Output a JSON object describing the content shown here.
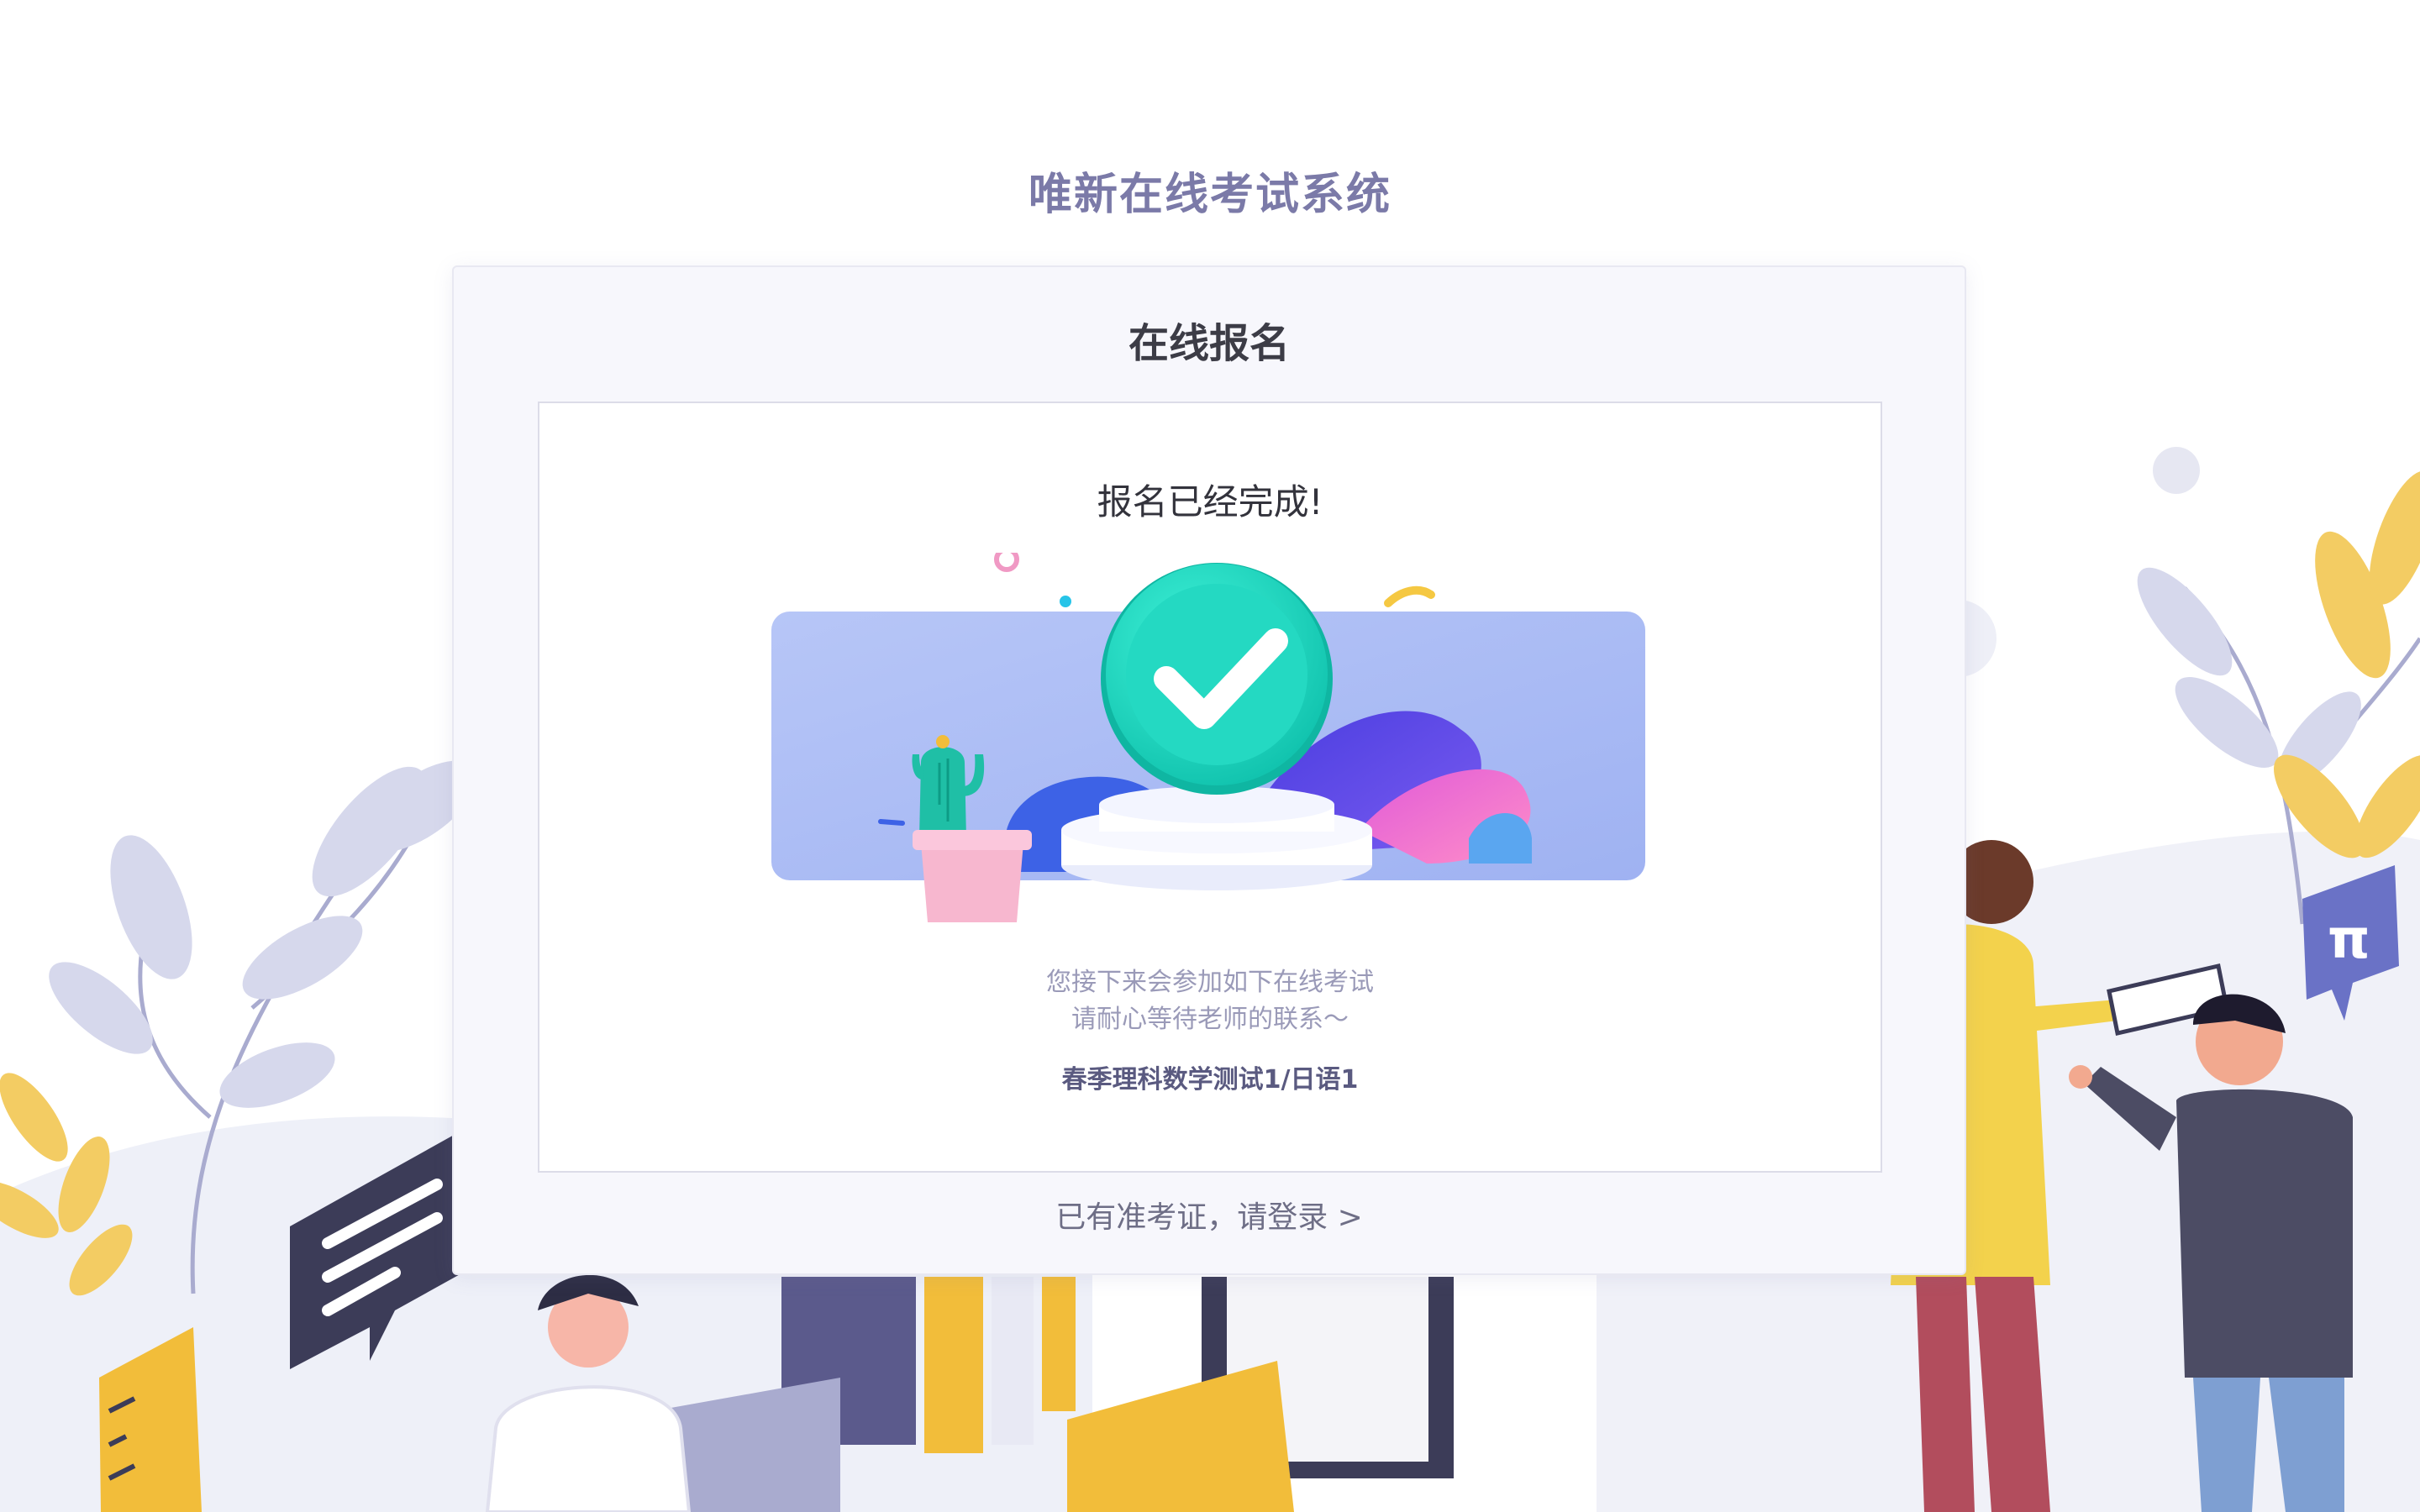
{
  "header": {
    "system_title": "唯新在线考试系统"
  },
  "card": {
    "title": "在线报名",
    "status_text": "报名已经完成!",
    "message_line1": "您接下来会参加如下在线考试",
    "message_line2": "请耐心等待老师的联系～",
    "exam_name": "春季理科数学测试1/日语1",
    "login_link": "已有准考证，请登录 >"
  },
  "colors": {
    "title": "#7b7aa8",
    "check_badge": "#22dfc6",
    "banner": "#a6b8f5"
  },
  "icons": {
    "success": "check-icon",
    "pi_bubble": "pi-icon"
  }
}
